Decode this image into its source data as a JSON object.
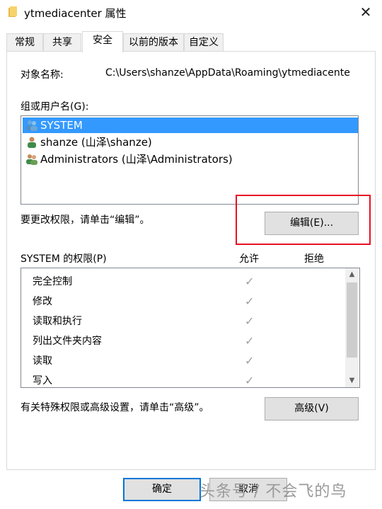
{
  "window": {
    "title": "ytmediacenter 属性",
    "close_glyph": "✕"
  },
  "tabs": [
    {
      "label": "常规"
    },
    {
      "label": "共享"
    },
    {
      "label": "安全"
    },
    {
      "label": "以前的版本"
    },
    {
      "label": "自定义"
    }
  ],
  "object": {
    "label": "对象名称:",
    "value": "C:\\Users\\shanze\\AppData\\Roaming\\ytmediacente"
  },
  "groups": {
    "label": "组或用户名(G):",
    "items": [
      {
        "name": "SYSTEM"
      },
      {
        "name": "shanze (山泽\\shanze)"
      },
      {
        "name": "Administrators (山泽\\Administrators)"
      }
    ]
  },
  "edit": {
    "hint": "要更改权限，请单击“编辑”。",
    "button_label": "编辑(E)..."
  },
  "permissions": {
    "title": "SYSTEM 的权限(P)",
    "allow_label": "允许",
    "deny_label": "拒绝",
    "rows": [
      {
        "name": "完全控制",
        "allow": "✓"
      },
      {
        "name": "修改",
        "allow": "✓"
      },
      {
        "name": "读取和执行",
        "allow": "✓"
      },
      {
        "name": "列出文件夹内容",
        "allow": "✓"
      },
      {
        "name": "读取",
        "allow": "✓"
      },
      {
        "name": "写入",
        "allow": "✓"
      }
    ]
  },
  "advanced": {
    "hint": "有关特殊权限或高级设置，请单击“高级”。",
    "button_label": "高级(V)"
  },
  "footer": {
    "ok_label": "确定",
    "cancel_label": "取消"
  },
  "watermark": "头条号 / 不会飞的鸟",
  "colors": {
    "selection": "#3399ff",
    "highlight_box": "#e81123"
  }
}
